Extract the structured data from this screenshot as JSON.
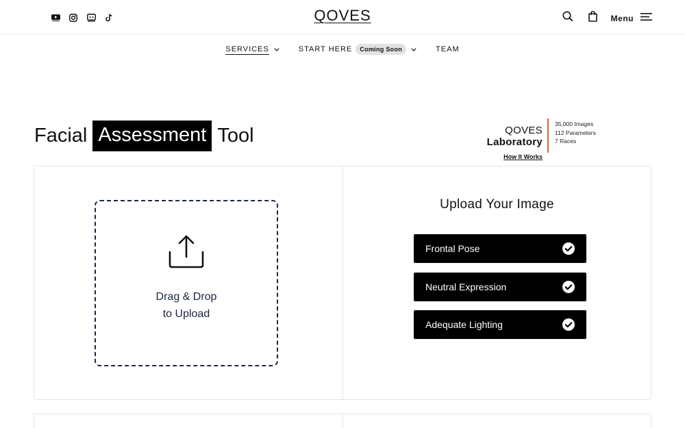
{
  "header": {
    "logo": "QOVES",
    "menu_label": "Menu",
    "social_icons": [
      "youtube-icon",
      "instagram-icon",
      "discord-icon",
      "tiktok-icon"
    ]
  },
  "nav": {
    "items": [
      {
        "label": "SERVICES",
        "active": true
      },
      {
        "label": "START HERE",
        "badge": "Coming Soon"
      },
      {
        "label": "TEAM"
      }
    ]
  },
  "hero": {
    "title_pre": "Facial",
    "title_highlight": "Assessment",
    "title_post": "Tool"
  },
  "lab": {
    "brand": "QOVES",
    "name": "Laboratory",
    "link": "How It Works",
    "stats": [
      "35,000 Images",
      "112 Parameters",
      "7 Races"
    ],
    "accent_color": "#e8602c"
  },
  "upload": {
    "dropzone_line1": "Drag & Drop",
    "dropzone_line2": "to Upload",
    "title": "Upload Your Image",
    "requirements": [
      "Frontal Pose",
      "Neutral Expression",
      "Adequate Lighting"
    ]
  }
}
